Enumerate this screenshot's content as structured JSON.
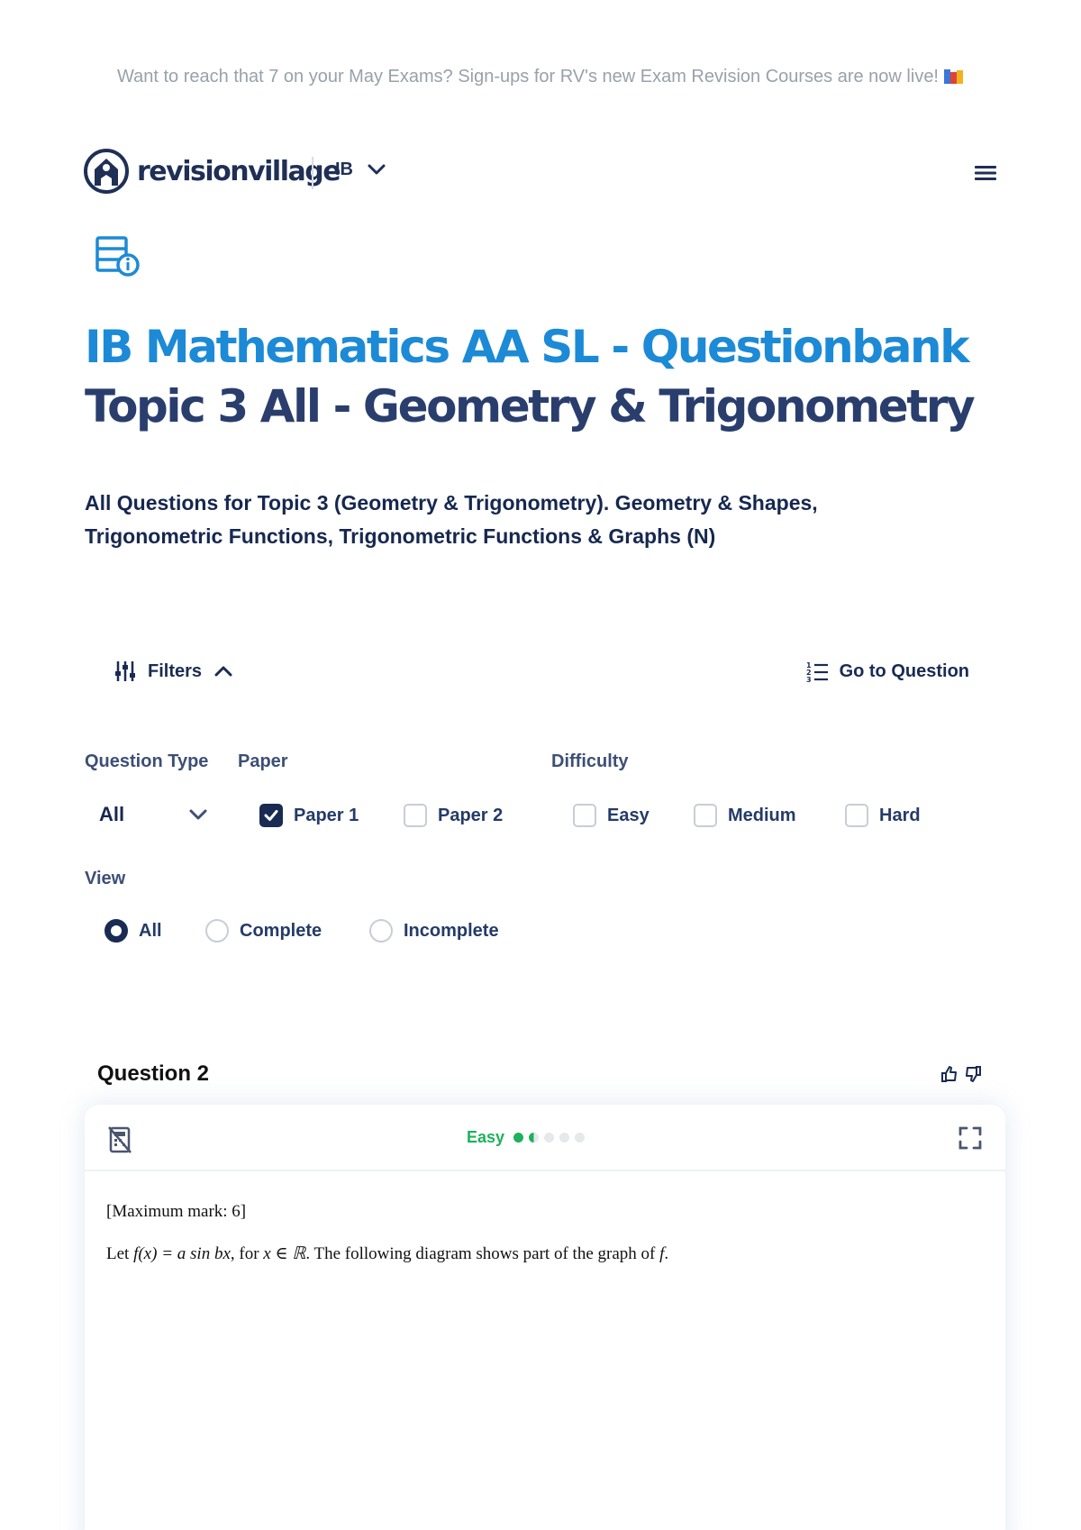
{
  "banner": {
    "text": "Want to reach that 7 on your May Exams? Sign-ups for RV's new Exam Revision Courses are now live!"
  },
  "header": {
    "logo_text": "revisionvillage",
    "curriculum": "IB",
    "icons": [
      "logo-mark",
      "chevron-down",
      "hamburger-menu"
    ]
  },
  "page": {
    "title_line1": "IB Mathematics AA SL - Questionbank",
    "title_line2": "Topic 3 All - Geometry & Trigonometry",
    "subtitle": "All Questions for Topic 3 (Geometry & Trigonometry). Geometry & Shapes, Trigonometric Functions, Trigonometric Functions & Graphs (N)",
    "accent_color": "#1c8ad6",
    "dark_color": "#2a3e6d"
  },
  "filters": {
    "toggle_label": "Filters",
    "goto_label": "Go to Question",
    "question_type_label": "Question Type",
    "question_type_value": "All",
    "paper_label": "Paper",
    "papers": [
      {
        "label": "Paper 1",
        "checked": true
      },
      {
        "label": "Paper 2",
        "checked": false
      }
    ],
    "difficulty_label": "Difficulty",
    "difficulties": [
      {
        "label": "Easy",
        "checked": false
      },
      {
        "label": "Medium",
        "checked": false
      },
      {
        "label": "Hard",
        "checked": false
      }
    ],
    "view_label": "View",
    "views": [
      {
        "label": "All",
        "selected": true
      },
      {
        "label": "Complete",
        "selected": false
      },
      {
        "label": "Incomplete",
        "selected": false
      }
    ]
  },
  "question": {
    "title": "Question 2",
    "difficulty_label": "Easy",
    "difficulty_level": 1.5,
    "difficulty_max": 5,
    "difficulty_color": "#1fb15b",
    "max_mark": "[Maximum mark: 6]",
    "text_prefix": "Let ",
    "text_math": "f(x) = a sin bx",
    "text_mid": ", for ",
    "text_math2": "x ∈ ℝ",
    "text_suffix": ". The following diagram shows part of the graph of ",
    "text_math3": "f",
    "text_end": "."
  }
}
